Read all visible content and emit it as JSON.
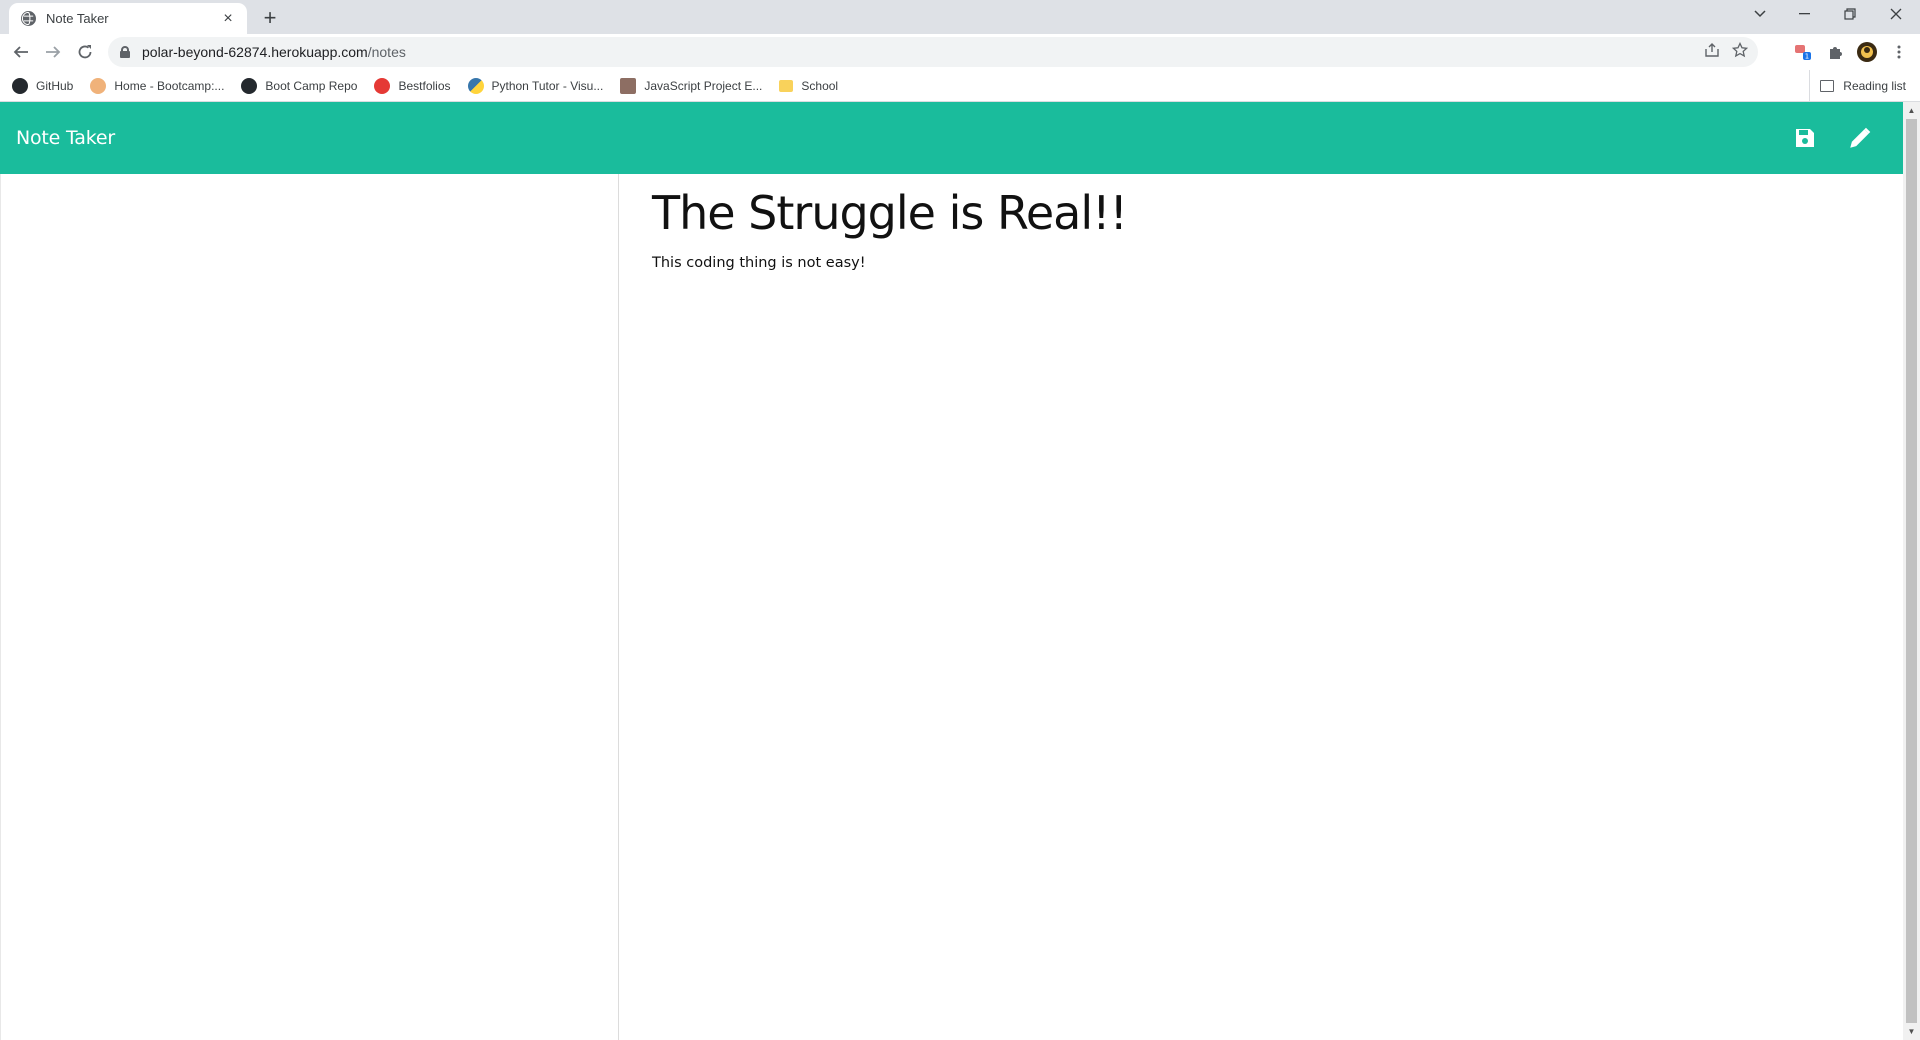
{
  "browser": {
    "tab_title": "Note Taker",
    "tab_close": "×",
    "new_tab": "+",
    "url_host": "polar-beyond-62874.herokuapp.com",
    "url_path": "/notes",
    "bookmarks": [
      {
        "label": "GitHub",
        "icon": "github-icon",
        "color": "#24292e"
      },
      {
        "label": "Home - Bootcamp:...",
        "icon": "bootcamp-icon",
        "color": "#f0b27a"
      },
      {
        "label": "Boot Camp Repo",
        "icon": "github-icon",
        "color": "#24292e"
      },
      {
        "label": "Bestfolios",
        "icon": "bestfolios-icon",
        "color": "#e53935"
      },
      {
        "label": "Python Tutor - Visu...",
        "icon": "python-icon",
        "color": "#3776ab"
      },
      {
        "label": "JavaScript Project E...",
        "icon": "js-project-icon",
        "color": "#8d6e63"
      },
      {
        "label": "School",
        "icon": "folder-icon",
        "color": "#f9d25b"
      }
    ],
    "reading_list": "Reading list"
  },
  "app": {
    "brand": "Note Taker",
    "accent": "#1abc9c",
    "save_icon": "save-icon",
    "edit_icon": "pencil-icon"
  },
  "note": {
    "title": "The Struggle is Real!!",
    "text": "This coding thing is not easy!"
  }
}
